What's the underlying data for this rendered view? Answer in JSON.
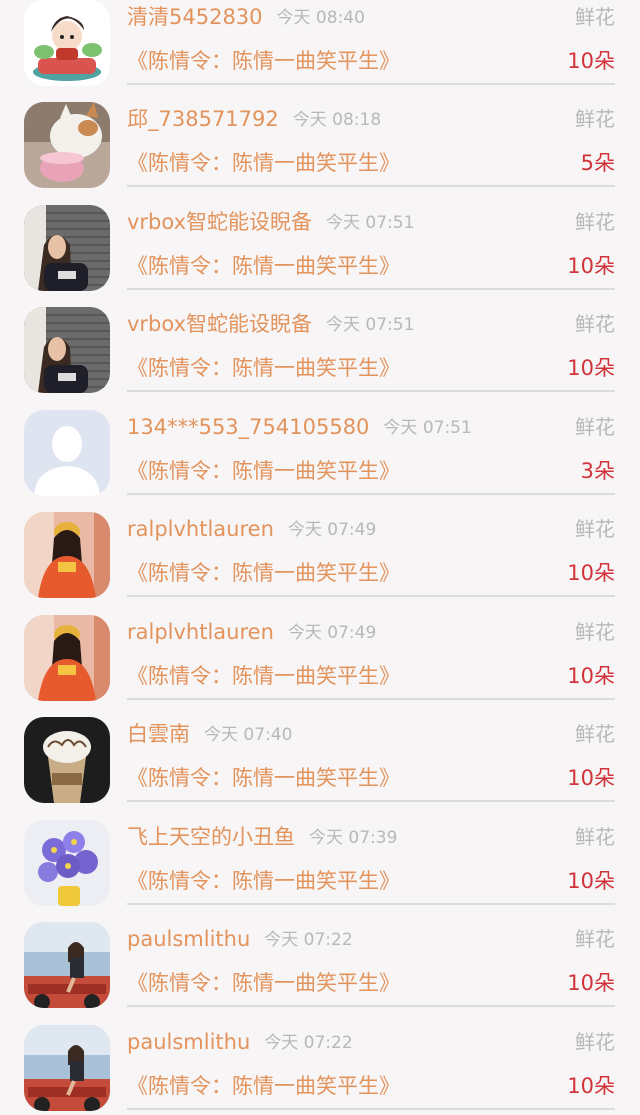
{
  "gift_label": "鲜花",
  "entries": [
    {
      "name": "清清5452830",
      "time": "今天 08:40",
      "work": "《陈情令：陈情一曲笑平生》",
      "count": "10朵",
      "avatar": "cartoon-girl-avatar"
    },
    {
      "name": "邱_738571792",
      "time": "今天 08:18",
      "work": "《陈情令：陈情一曲笑平生》",
      "count": "5朵",
      "avatar": "cat-cake-avatar"
    },
    {
      "name": "vrbox智蛇能设睨备",
      "time": "今天 07:51",
      "work": "《陈情令：陈情一曲笑平生》",
      "count": "10朵",
      "avatar": "woman-shutter-avatar"
    },
    {
      "name": "vrbox智蛇能设睨备",
      "time": "今天 07:51",
      "work": "《陈情令：陈情一曲笑平生》",
      "count": "10朵",
      "avatar": "woman-shutter-avatar"
    },
    {
      "name": "134***553_754105580",
      "time": "今天 07:51",
      "work": "《陈情令：陈情一曲笑平生》",
      "count": "3朵",
      "avatar": "default-user-avatar"
    },
    {
      "name": "ralplvhtlauren",
      "time": "今天 07:49",
      "work": "《陈情令：陈情一曲笑平生》",
      "count": "10朵",
      "avatar": "hanfu-girl-avatar"
    },
    {
      "name": "ralplvhtlauren",
      "time": "今天 07:49",
      "work": "《陈情令：陈情一曲笑平生》",
      "count": "10朵",
      "avatar": "hanfu-girl-avatar"
    },
    {
      "name": "白雲南",
      "time": "今天 07:40",
      "work": "《陈情令：陈情一曲笑平生》",
      "count": "10朵",
      "avatar": "frappuccino-avatar"
    },
    {
      "name": "飞上天空的小丑鱼",
      "time": "今天 07:39",
      "work": "《陈情令：陈情一曲笑平生》",
      "count": "10朵",
      "avatar": "violet-flowers-avatar"
    },
    {
      "name": "paulsmlithu",
      "time": "今天 07:22",
      "work": "《陈情令：陈情一曲笑平生》",
      "count": "10朵",
      "avatar": "jeep-woman-avatar"
    },
    {
      "name": "paulsmlithu",
      "time": "今天 07:22",
      "work": "《陈情令：陈情一曲笑平生》",
      "count": "10朵",
      "avatar": "jeep-woman-avatar"
    }
  ]
}
